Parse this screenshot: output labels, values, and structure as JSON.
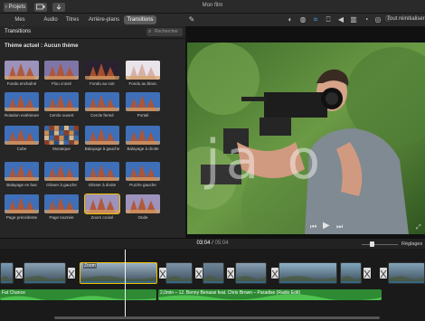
{
  "titlebar": {
    "back_label": "‹ Projets",
    "window_title": "Mon film"
  },
  "tabs": [
    {
      "label": "Mes données",
      "active": false
    },
    {
      "label": "Audio",
      "active": false
    },
    {
      "label": "Titres",
      "active": false
    },
    {
      "label": "Arrière-plans",
      "active": false
    },
    {
      "label": "Transitions",
      "active": true
    }
  ],
  "viewer_toolbar": {
    "icons": [
      "magic-wand-icon",
      "color-balance-icon",
      "color-correction-icon",
      "crop-icon",
      "stabilize-icon",
      "volume-icon",
      "equalizer-icon",
      "speed-icon",
      "filter-icon",
      "info-icon"
    ],
    "reset_all": "Tout réinitialiser"
  },
  "browser": {
    "title": "Transitions",
    "search_placeholder": "Rechercher",
    "theme_label": "Thème actuel : Aucun thème",
    "tiles": [
      {
        "label": "Fondu enchaîné",
        "style": "fog"
      },
      {
        "label": "Flou croisé",
        "style": "blur"
      },
      {
        "label": "Fondu au noir",
        "style": "black"
      },
      {
        "label": "Fondu au blanc",
        "style": "white"
      },
      {
        "label": "Rotation extérieure",
        "style": "sky"
      },
      {
        "label": "Cercle ouvert",
        "style": "sky"
      },
      {
        "label": "Cercle fermé",
        "style": "sky"
      },
      {
        "label": "Portail",
        "style": "sky"
      },
      {
        "label": "Cube",
        "style": "sky"
      },
      {
        "label": "Mosaïque",
        "style": "mosaic"
      },
      {
        "label": "Balayage à gauche",
        "style": "sky"
      },
      {
        "label": "Balayage à droite",
        "style": "sky"
      },
      {
        "label": "Balayage en bas",
        "style": "sky"
      },
      {
        "label": "Glisser à gauche",
        "style": "sky"
      },
      {
        "label": "Glisser à droite",
        "style": "sky"
      },
      {
        "label": "Puzzle gauche",
        "style": "sky"
      },
      {
        "label": "Page précédente",
        "style": "sky"
      },
      {
        "label": "Page tournée",
        "style": "sky"
      },
      {
        "label": "Zoom croisé",
        "style": "fog",
        "selected": true
      },
      {
        "label": "Onde",
        "style": "fog"
      }
    ]
  },
  "viewer": {
    "watermark": "ja  o"
  },
  "timeline": {
    "current_time": "03:04",
    "separator": " / ",
    "total_time": "05:04",
    "settings_label": "Réglages",
    "clip_title": "Zoom",
    "audio_track_1": "Fat Chance",
    "audio_track_2": "2,0min – 12. Benny Benassi feat. Chris Brown – Paradise (Radio Edit)"
  },
  "colors": {
    "accent": "#f0c000",
    "audio_green": "#2f8f2f",
    "selected_tab": "#5a5a5a"
  }
}
